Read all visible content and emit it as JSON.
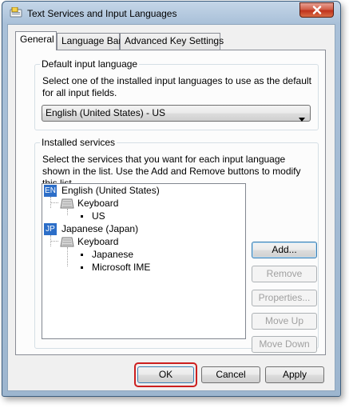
{
  "window": {
    "title": "Text Services and Input Languages"
  },
  "tabs": [
    {
      "label": "General",
      "active": true
    },
    {
      "label": "Language Bar",
      "active": false
    },
    {
      "label": "Advanced Key Settings",
      "active": false
    }
  ],
  "default_input": {
    "group_title": "Default input language",
    "description": "Select one of the installed input languages to use as the default for all input fields.",
    "selected": "English (United States) - US"
  },
  "installed_services": {
    "group_title": "Installed services",
    "description": "Select the services that you want for each input language shown in the list. Use the Add and Remove buttons to modify this list.",
    "tree": {
      "english_badge": "EN",
      "english_label": "English (United States)",
      "english_keyboard_label": "Keyboard",
      "english_layout": "US",
      "japanese_badge": "JP",
      "japanese_label": "Japanese (Japan)",
      "japanese_keyboard_label": "Keyboard",
      "japanese_layout_1": "Japanese",
      "japanese_layout_2": "Microsoft IME"
    },
    "buttons": {
      "add": "Add...",
      "remove": "Remove",
      "properties": "Properties...",
      "move_up": "Move Up",
      "move_down": "Move Down"
    }
  },
  "footer": {
    "ok": "OK",
    "cancel": "Cancel",
    "apply": "Apply"
  },
  "colors": {
    "highlight_ring": "#cc1f1f",
    "language_badge": "#2c6ec8"
  },
  "icons": {
    "app": "text-services-icon",
    "close": "close-icon",
    "dropdown": "chevron-down-icon",
    "keyboard": "keyboard-icon"
  }
}
